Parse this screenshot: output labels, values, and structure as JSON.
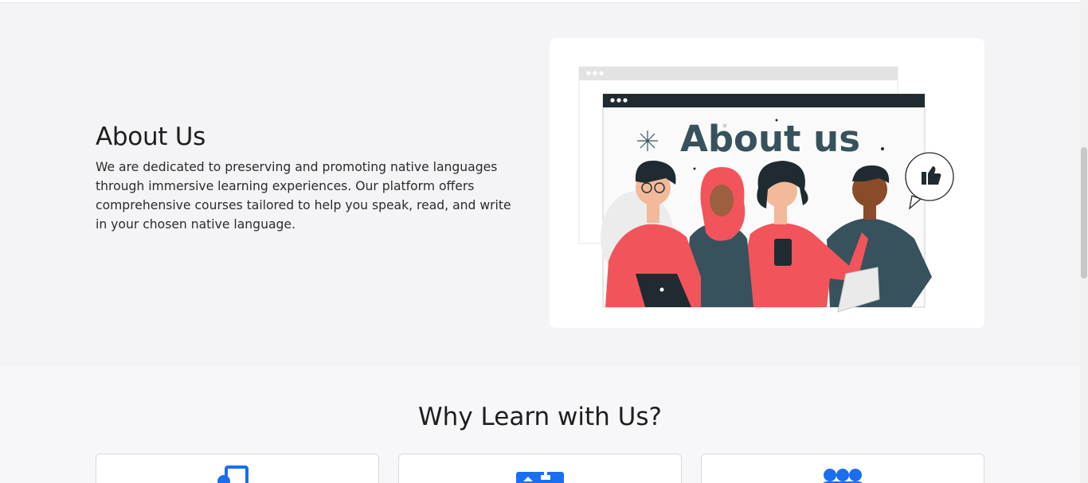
{
  "about": {
    "title": "About Us",
    "description": "We are dedicated to preserving and promoting native languages through immersive learning experiences. Our platform offers comprehensive courses tailored to help you speak, read, and write in your chosen native language.",
    "illustration_heading": "About us"
  },
  "why": {
    "title": "Why Learn with Us?",
    "features": [
      {
        "icon": "device-screen-icon"
      },
      {
        "icon": "id-card-icon"
      },
      {
        "icon": "users-group-icon"
      }
    ]
  },
  "colors": {
    "accent": "#1a6ef0",
    "coral": "#f2545b",
    "slate": "#37525c",
    "page_bg": "#f4f4f6"
  }
}
